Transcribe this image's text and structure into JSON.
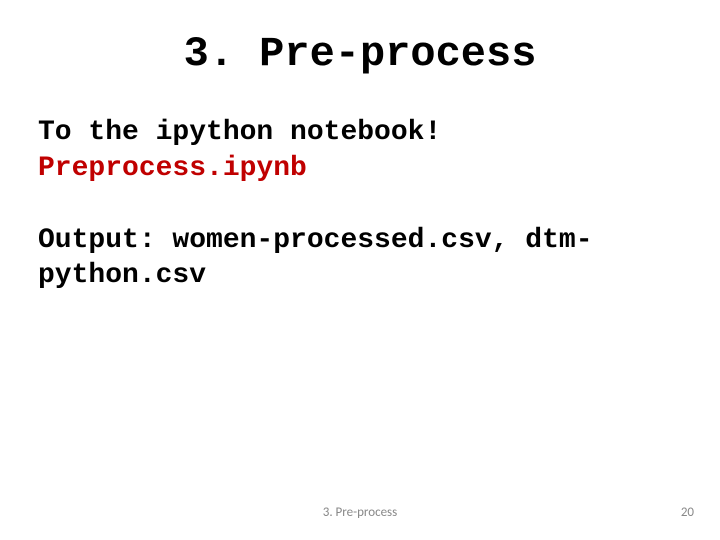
{
  "title": "3. Pre-process",
  "body": {
    "line1": "To the ipython notebook!",
    "line2": "Preprocess.ipynb",
    "line3": "Output: women-processed.csv, dtm-python.csv"
  },
  "footer": {
    "section": "3. Pre-process",
    "page": "20"
  }
}
